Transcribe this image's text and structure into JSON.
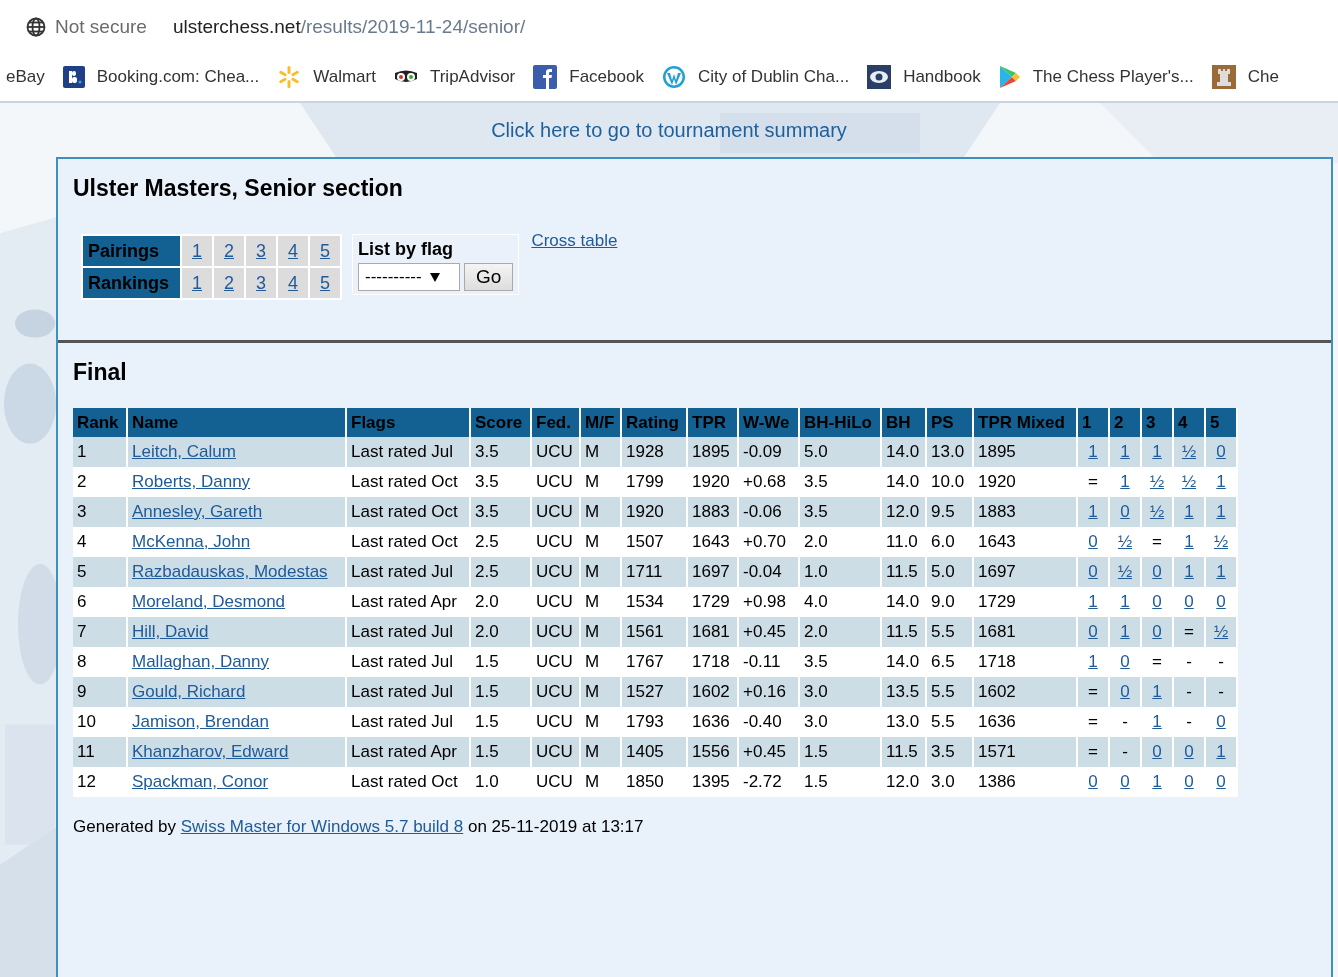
{
  "browser": {
    "security": "Not secure",
    "url_host": "ulsterchess.net",
    "url_path": "/results/2019-11-24/senior/",
    "bookmarks": [
      {
        "label": "eBay"
      },
      {
        "label": "Booking.com: Chea..."
      },
      {
        "label": "Walmart"
      },
      {
        "label": "TripAdvisor"
      },
      {
        "label": "Facebook"
      },
      {
        "label": "City of Dublin Cha..."
      },
      {
        "label": "Handbook"
      },
      {
        "label": "The Chess Player's..."
      },
      {
        "label": "Che"
      }
    ]
  },
  "summary_link": "Click here to go to tournament summary",
  "section_title": "Ulster Masters, Senior section",
  "nav": [
    {
      "label": "Pairings",
      "rounds": [
        "1",
        "2",
        "3",
        "4",
        "5"
      ]
    },
    {
      "label": "Rankings",
      "rounds": [
        "1",
        "2",
        "3",
        "4",
        "5"
      ]
    }
  ],
  "flag_filter": {
    "label": "List by flag",
    "value": "----------",
    "button": "Go"
  },
  "cross_table_link": "Cross table",
  "heading": "Final",
  "table": {
    "columns": [
      "Rank",
      "Name",
      "Flags",
      "Score",
      "Fed.",
      "M/F",
      "Rating",
      "TPR",
      "W-We",
      "BH-HiLo",
      "BH",
      "PS",
      "TPR Mixed",
      "1",
      "2",
      "3",
      "4",
      "5"
    ],
    "rows": [
      {
        "cells": [
          "1",
          "Leitch, Calum",
          "Last rated Jul",
          "3.5",
          "UCU",
          "M",
          "1928",
          "1895",
          "-0.09",
          "5.0",
          "14.0",
          "13.0",
          "1895"
        ],
        "results": [
          {
            "v": "1",
            "linked": true
          },
          {
            "v": "1",
            "linked": true
          },
          {
            "v": "1",
            "linked": true
          },
          {
            "v": "½",
            "linked": true
          },
          {
            "v": "0",
            "linked": true
          }
        ]
      },
      {
        "cells": [
          "2",
          "Roberts, Danny",
          "Last rated Oct",
          "3.5",
          "UCU",
          "M",
          "1799",
          "1920",
          "+0.68",
          "3.5",
          "14.0",
          "10.0",
          "1920"
        ],
        "results": [
          {
            "v": "=",
            "linked": false
          },
          {
            "v": "1",
            "linked": true
          },
          {
            "v": "½",
            "linked": true
          },
          {
            "v": "½",
            "linked": true
          },
          {
            "v": "1",
            "linked": true
          }
        ]
      },
      {
        "cells": [
          "3",
          "Annesley, Gareth",
          "Last rated Oct",
          "3.5",
          "UCU",
          "M",
          "1920",
          "1883",
          "-0.06",
          "3.5",
          "12.0",
          "9.5",
          "1883"
        ],
        "results": [
          {
            "v": "1",
            "linked": true
          },
          {
            "v": "0",
            "linked": true
          },
          {
            "v": "½",
            "linked": true
          },
          {
            "v": "1",
            "linked": true
          },
          {
            "v": "1",
            "linked": true
          }
        ]
      },
      {
        "cells": [
          "4",
          "McKenna, John",
          "Last rated Oct",
          "2.5",
          "UCU",
          "M",
          "1507",
          "1643",
          "+0.70",
          "2.0",
          "11.0",
          "6.0",
          "1643"
        ],
        "results": [
          {
            "v": "0",
            "linked": true
          },
          {
            "v": "½",
            "linked": true
          },
          {
            "v": "=",
            "linked": false
          },
          {
            "v": "1",
            "linked": true
          },
          {
            "v": "½",
            "linked": true
          }
        ]
      },
      {
        "cells": [
          "5",
          "Razbadauskas, Modestas",
          "Last rated Jul",
          "2.5",
          "UCU",
          "M",
          "1711",
          "1697",
          "-0.04",
          "1.0",
          "11.5",
          "5.0",
          "1697"
        ],
        "results": [
          {
            "v": "0",
            "linked": true
          },
          {
            "v": "½",
            "linked": true
          },
          {
            "v": "0",
            "linked": true
          },
          {
            "v": "1",
            "linked": true
          },
          {
            "v": "1",
            "linked": true
          }
        ]
      },
      {
        "cells": [
          "6",
          "Moreland, Desmond",
          "Last rated Apr",
          "2.0",
          "UCU",
          "M",
          "1534",
          "1729",
          "+0.98",
          "4.0",
          "14.0",
          "9.0",
          "1729"
        ],
        "results": [
          {
            "v": "1",
            "linked": true
          },
          {
            "v": "1",
            "linked": true
          },
          {
            "v": "0",
            "linked": true
          },
          {
            "v": "0",
            "linked": true
          },
          {
            "v": "0",
            "linked": true
          }
        ]
      },
      {
        "cells": [
          "7",
          "Hill, David",
          "Last rated Jul",
          "2.0",
          "UCU",
          "M",
          "1561",
          "1681",
          "+0.45",
          "2.0",
          "11.5",
          "5.5",
          "1681"
        ],
        "results": [
          {
            "v": "0",
            "linked": true
          },
          {
            "v": "1",
            "linked": true
          },
          {
            "v": "0",
            "linked": true
          },
          {
            "v": "=",
            "linked": false
          },
          {
            "v": "½",
            "linked": true
          }
        ]
      },
      {
        "cells": [
          "8",
          "Mallaghan, Danny",
          "Last rated Jul",
          "1.5",
          "UCU",
          "M",
          "1767",
          "1718",
          "-0.11",
          "3.5",
          "14.0",
          "6.5",
          "1718"
        ],
        "results": [
          {
            "v": "1",
            "linked": true
          },
          {
            "v": "0",
            "linked": true
          },
          {
            "v": "=",
            "linked": false
          },
          {
            "v": "-",
            "linked": false
          },
          {
            "v": "-",
            "linked": false
          }
        ]
      },
      {
        "cells": [
          "9",
          "Gould, Richard",
          "Last rated Jul",
          "1.5",
          "UCU",
          "M",
          "1527",
          "1602",
          "+0.16",
          "3.0",
          "13.5",
          "5.5",
          "1602"
        ],
        "results": [
          {
            "v": "=",
            "linked": false
          },
          {
            "v": "0",
            "linked": true
          },
          {
            "v": "1",
            "linked": true
          },
          {
            "v": "-",
            "linked": false
          },
          {
            "v": "-",
            "linked": false
          }
        ]
      },
      {
        "cells": [
          "10",
          "Jamison, Brendan",
          "Last rated Jul",
          "1.5",
          "UCU",
          "M",
          "1793",
          "1636",
          "-0.40",
          "3.0",
          "13.0",
          "5.5",
          "1636"
        ],
        "results": [
          {
            "v": "=",
            "linked": false
          },
          {
            "v": "-",
            "linked": false
          },
          {
            "v": "1",
            "linked": true
          },
          {
            "v": "-",
            "linked": false
          },
          {
            "v": "0",
            "linked": true
          }
        ]
      },
      {
        "cells": [
          "11",
          "Khanzharov, Edward",
          "Last rated Apr",
          "1.5",
          "UCU",
          "M",
          "1405",
          "1556",
          "+0.45",
          "1.5",
          "11.5",
          "3.5",
          "1571"
        ],
        "results": [
          {
            "v": "=",
            "linked": false
          },
          {
            "v": "-",
            "linked": false
          },
          {
            "v": "0",
            "linked": true
          },
          {
            "v": "0",
            "linked": true
          },
          {
            "v": "1",
            "linked": true
          }
        ]
      },
      {
        "cells": [
          "12",
          "Spackman, Conor",
          "Last rated Oct",
          "1.0",
          "UCU",
          "M",
          "1850",
          "1395",
          "-2.72",
          "1.5",
          "12.0",
          "3.0",
          "1386"
        ],
        "results": [
          {
            "v": "0",
            "linked": true
          },
          {
            "v": "0",
            "linked": true
          },
          {
            "v": "1",
            "linked": true
          },
          {
            "v": "0",
            "linked": true
          },
          {
            "v": "0",
            "linked": true
          }
        ]
      }
    ]
  },
  "footer": {
    "prefix": "Generated by",
    "link": "Swiss Master for Windows 5.7 build 8",
    "suffix": "on 25-11-2019 at 13:17"
  }
}
